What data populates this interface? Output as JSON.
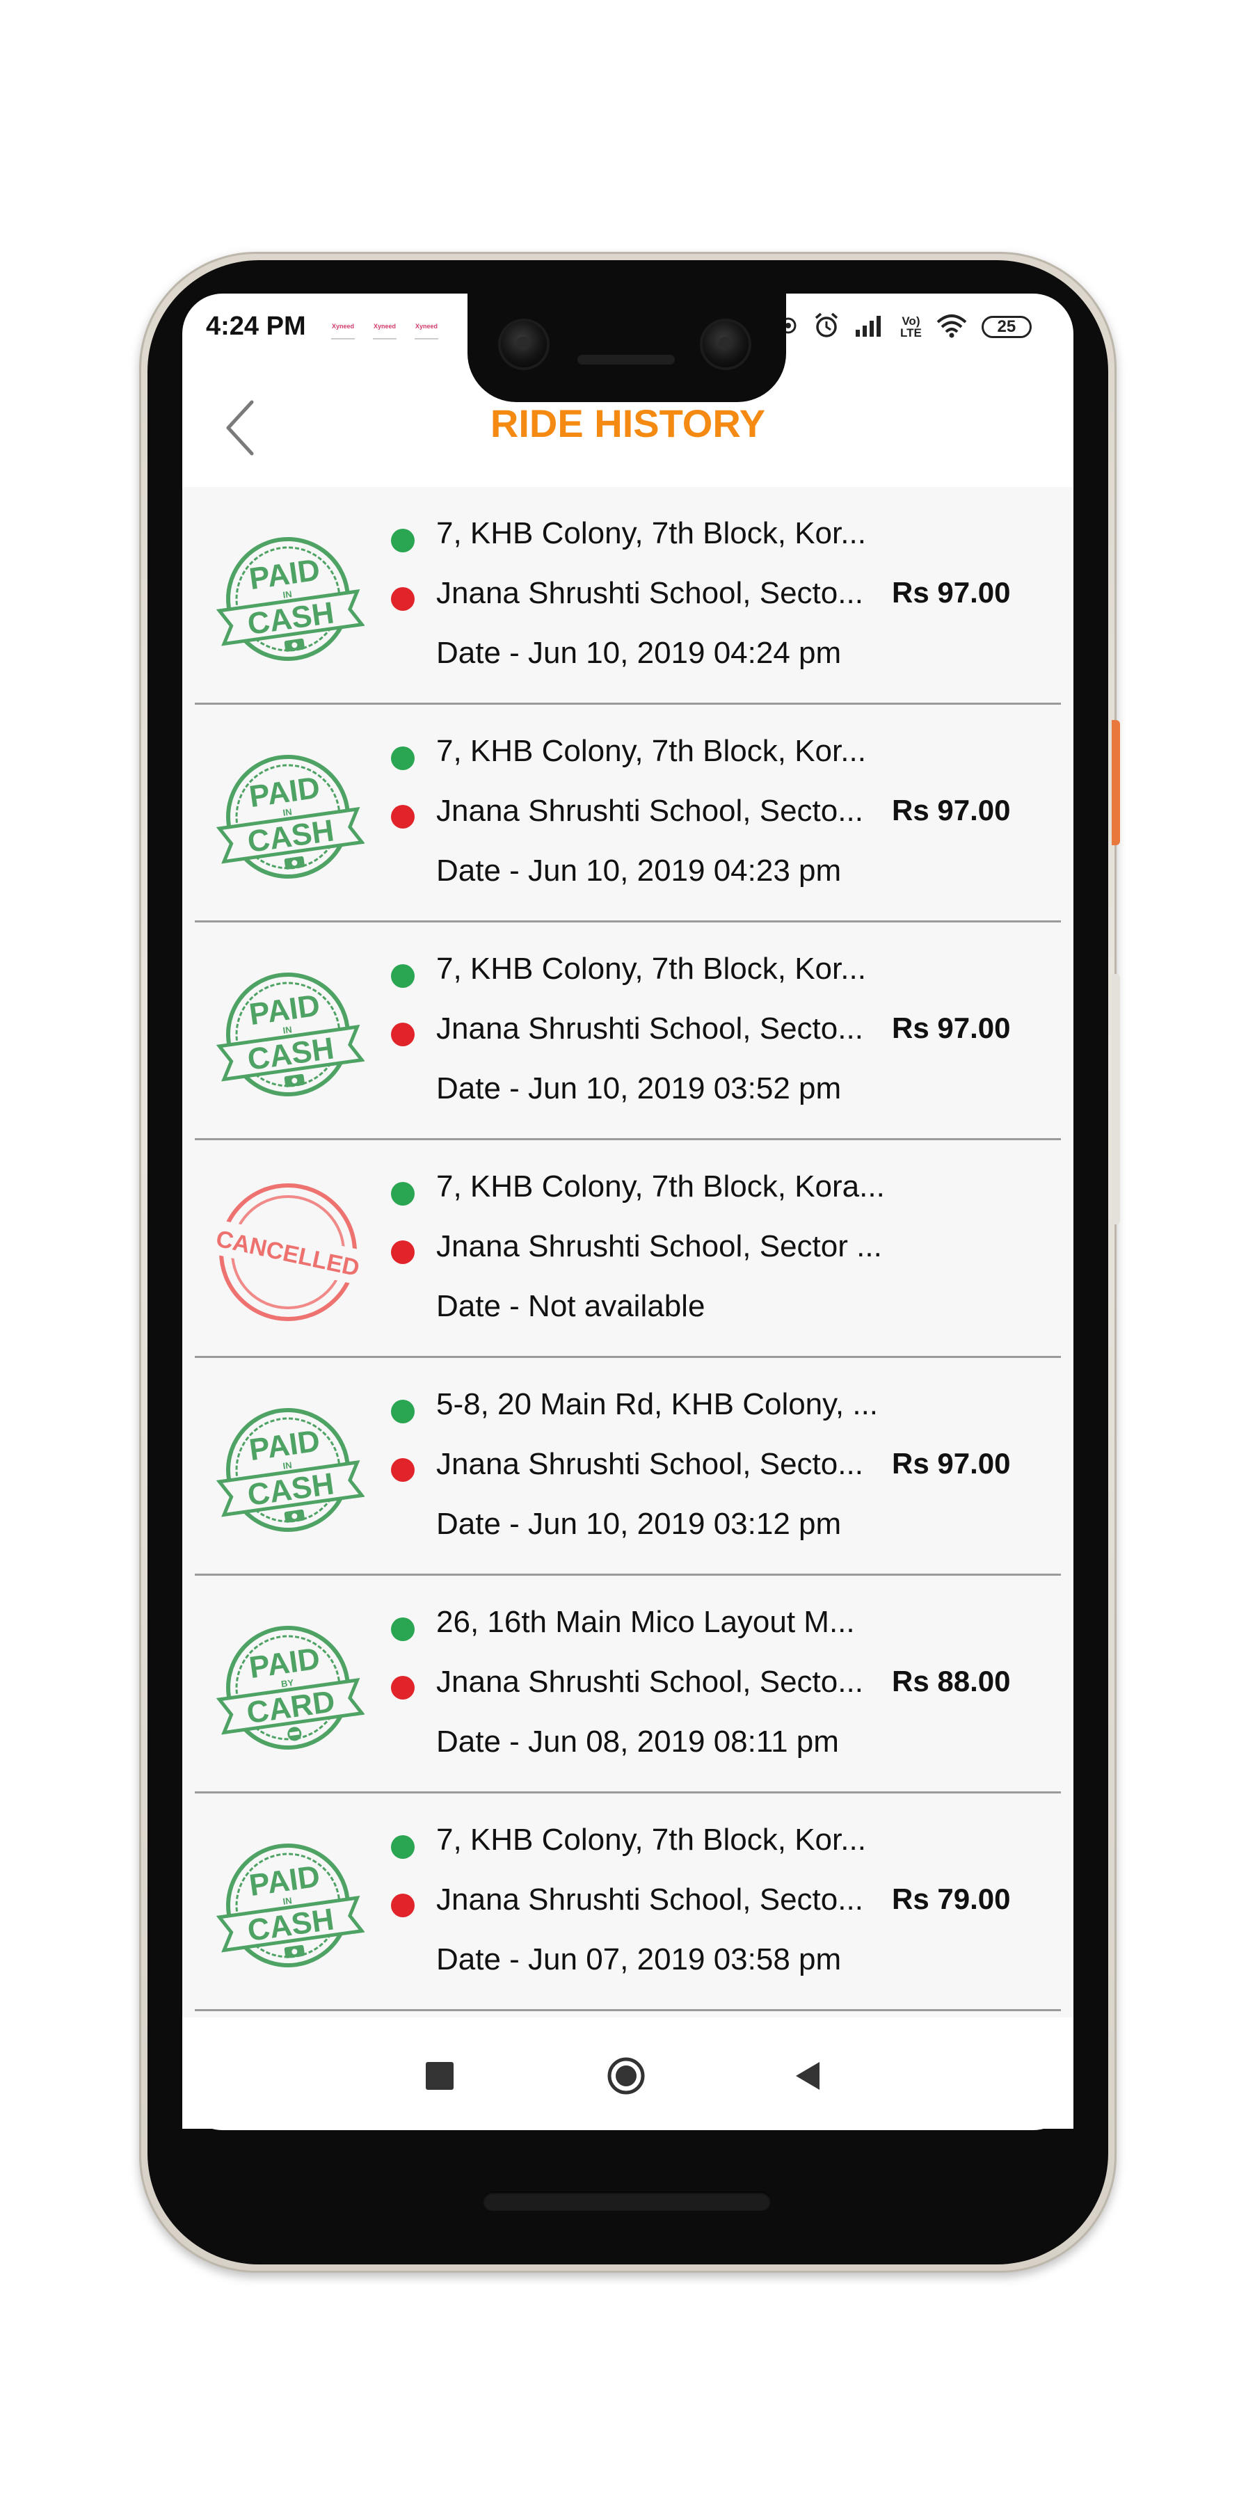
{
  "status_bar": {
    "time": "4:24 PM",
    "notification_label": "Xyneed",
    "network_label_top": "Vo)",
    "network_label_bottom": "LTE",
    "battery": "25"
  },
  "header": {
    "title": "RIDE HISTORY",
    "back_icon": "chevron-left-icon"
  },
  "rides": [
    {
      "stamp": "paid-in-cash",
      "stamp_top": "PAID",
      "stamp_mid": "IN",
      "stamp_bottom": "CASH",
      "pickup": "7, KHB Colony, 7th Block, Kor...",
      "drop": "Jnana Shrushti School, Secto...",
      "date": "Date - Jun 10, 2019 04:24 pm",
      "fare": "Rs 97.00"
    },
    {
      "stamp": "paid-in-cash",
      "stamp_top": "PAID",
      "stamp_mid": "IN",
      "stamp_bottom": "CASH",
      "pickup": "7, KHB Colony, 7th Block, Kor...",
      "drop": "Jnana Shrushti School, Secto...",
      "date": "Date - Jun 10, 2019 04:23 pm",
      "fare": "Rs 97.00"
    },
    {
      "stamp": "paid-in-cash",
      "stamp_top": "PAID",
      "stamp_mid": "IN",
      "stamp_bottom": "CASH",
      "pickup": "7, KHB Colony, 7th Block, Kor...",
      "drop": "Jnana Shrushti School, Secto...",
      "date": "Date - Jun 10, 2019 03:52 pm",
      "fare": "Rs 97.00"
    },
    {
      "stamp": "cancelled",
      "stamp_text": "CANCELLED",
      "pickup": "7, KHB Colony, 7th Block, Kora...",
      "drop": "Jnana Shrushti School, Sector ...",
      "date": "Date - Not available",
      "fare": ""
    },
    {
      "stamp": "paid-in-cash",
      "stamp_top": "PAID",
      "stamp_mid": "IN",
      "stamp_bottom": "CASH",
      "pickup": "5-8, 20 Main Rd, KHB Colony, ...",
      "drop": "Jnana Shrushti School, Secto...",
      "date": "Date - Jun 10, 2019 03:12 pm",
      "fare": "Rs 97.00"
    },
    {
      "stamp": "paid-by-card",
      "stamp_top": "PAID",
      "stamp_mid": "BY",
      "stamp_bottom": "CARD",
      "pickup": "26, 16th Main Mico Layout M...",
      "drop": "Jnana Shrushti School, Secto...",
      "date": "Date - Jun 08, 2019 08:11 pm",
      "fare": "Rs 88.00"
    },
    {
      "stamp": "paid-in-cash",
      "stamp_top": "PAID",
      "stamp_mid": "IN",
      "stamp_bottom": "CASH",
      "pickup": "7, KHB Colony, 7th Block, Kor...",
      "drop": "Jnana Shrushti School, Secto...",
      "date": "Date - Jun 07, 2019 03:58 pm",
      "fare": "Rs 79.00"
    }
  ],
  "nav_bar": {
    "recent_icon": "square-recent-apps-icon",
    "home_icon": "circle-home-icon",
    "back_icon": "triangle-back-icon"
  },
  "colors": {
    "title": "#f58a13",
    "paid_stamp": "#3c9a55",
    "cancelled_stamp": "#ec5a57",
    "pickup_dot": "#2aa552",
    "drop_dot": "#e1232a"
  }
}
